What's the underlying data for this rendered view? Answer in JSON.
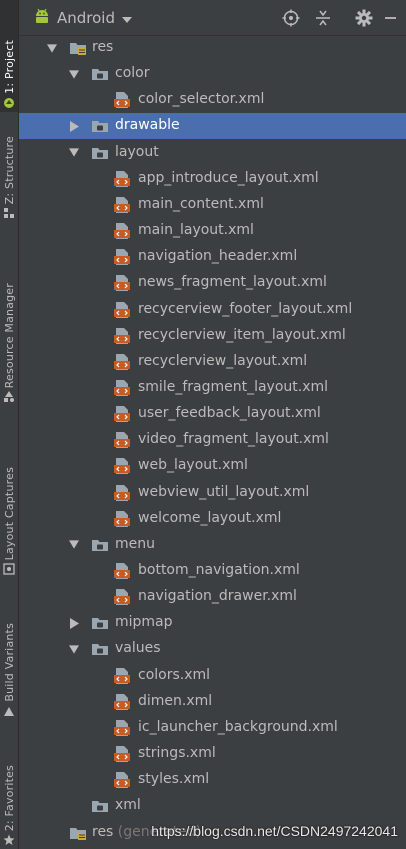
{
  "header": {
    "view_label": "Android",
    "icons": [
      "android-icon",
      "chevron-down-icon",
      "locate-target-icon",
      "collapse-all-icon",
      "gear-icon",
      "hide-panel-icon"
    ]
  },
  "side_tabs": [
    {
      "label": "1: Project",
      "icon": "project-folder-icon",
      "active": true
    },
    {
      "label": "Z: Structure",
      "icon": "structure-icon",
      "active": false
    },
    {
      "label": "Resource Manager",
      "icon": "resource-manager-icon",
      "active": false
    },
    {
      "label": "Layout Captures",
      "icon": "layout-capture-icon",
      "active": false
    },
    {
      "label": "Build Variants",
      "icon": "build-variants-icon",
      "active": false
    },
    {
      "label": "2: Favorites",
      "icon": "star-icon",
      "active": false
    }
  ],
  "tree": [
    {
      "label": "res",
      "kind": "res-folder",
      "level": 0,
      "arrow": "down"
    },
    {
      "label": "color",
      "kind": "folder",
      "level": 1,
      "arrow": "down"
    },
    {
      "label": "color_selector.xml",
      "kind": "xml-file",
      "level": 2
    },
    {
      "label": "drawable",
      "kind": "folder",
      "level": 1,
      "arrow": "right",
      "selected": true
    },
    {
      "label": "layout",
      "kind": "folder",
      "level": 1,
      "arrow": "down"
    },
    {
      "label": "app_introduce_layout.xml",
      "kind": "xml-file",
      "level": 2
    },
    {
      "label": "main_content.xml",
      "kind": "xml-file",
      "level": 2
    },
    {
      "label": "main_layout.xml",
      "kind": "xml-file",
      "level": 2
    },
    {
      "label": "navigation_header.xml",
      "kind": "xml-file",
      "level": 2
    },
    {
      "label": "news_fragment_layout.xml",
      "kind": "xml-file",
      "level": 2
    },
    {
      "label": "recycerview_footer_layout.xml",
      "kind": "xml-file",
      "level": 2
    },
    {
      "label": "recyclerview_item_layout.xml",
      "kind": "xml-file",
      "level": 2
    },
    {
      "label": "recyclerview_layout.xml",
      "kind": "xml-file",
      "level": 2
    },
    {
      "label": "smile_fragment_layout.xml",
      "kind": "xml-file",
      "level": 2
    },
    {
      "label": "user_feedback_layout.xml",
      "kind": "xml-file",
      "level": 2
    },
    {
      "label": "video_fragment_layout.xml",
      "kind": "xml-file",
      "level": 2
    },
    {
      "label": "web_layout.xml",
      "kind": "xml-file",
      "level": 2
    },
    {
      "label": "webview_util_layout.xml",
      "kind": "xml-file",
      "level": 2
    },
    {
      "label": "welcome_layout.xml",
      "kind": "xml-file",
      "level": 2
    },
    {
      "label": "menu",
      "kind": "folder",
      "level": 1,
      "arrow": "down"
    },
    {
      "label": "bottom_navigation.xml",
      "kind": "xml-file",
      "level": 2
    },
    {
      "label": "navigation_drawer.xml",
      "kind": "xml-file",
      "level": 2
    },
    {
      "label": "mipmap",
      "kind": "folder",
      "level": 1,
      "arrow": "right"
    },
    {
      "label": "values",
      "kind": "folder",
      "level": 1,
      "arrow": "down"
    },
    {
      "label": "colors.xml",
      "kind": "xml-file",
      "level": 2
    },
    {
      "label": "dimen.xml",
      "kind": "xml-file",
      "level": 2
    },
    {
      "label": "ic_launcher_background.xml",
      "kind": "xml-file",
      "level": 2
    },
    {
      "label": "strings.xml",
      "kind": "xml-file",
      "level": 2
    },
    {
      "label": "styles.xml",
      "kind": "xml-file",
      "level": 2
    },
    {
      "label": "xml",
      "kind": "folder",
      "level": 1
    },
    {
      "label": "res",
      "suffix": " (generated)",
      "kind": "res-folder",
      "level": 0
    }
  ],
  "watermark": "https://blog.csdn.net/CSDN2497242041",
  "colors": {
    "background": "#3c3f41",
    "selection": "#4b6eaf",
    "text": "#bbbbbb",
    "xml_icon": "#c75b22",
    "folder_icon": "#9aa7b0",
    "android_green": "#a4c639"
  }
}
